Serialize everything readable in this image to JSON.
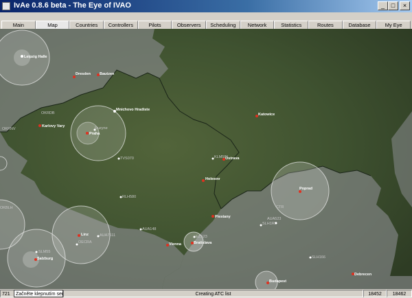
{
  "window": {
    "title": "IvAe 0.8.6 beta - The Eye of IVAO",
    "controls": [
      "_",
      "□",
      "×"
    ]
  },
  "tabs": [
    {
      "label": "Main"
    },
    {
      "label": "Map"
    },
    {
      "label": "Countries"
    },
    {
      "label": "Controllers"
    },
    {
      "label": "Pilots"
    },
    {
      "label": "Observers"
    },
    {
      "label": "Scheduling"
    },
    {
      "label": "Network"
    },
    {
      "label": "Statistics"
    },
    {
      "label": "Routes"
    },
    {
      "label": "Database"
    },
    {
      "label": "My Eye"
    }
  ],
  "active_tab": "Map",
  "map": {
    "cities": [
      {
        "name": "Leipzig Halle"
      },
      {
        "name": "Dresden"
      },
      {
        "name": "Bautzen"
      },
      {
        "name": "Mnichovo Hradiste"
      },
      {
        "name": "Karlovy Vary"
      },
      {
        "name": "Praha"
      },
      {
        "name": "Katowice"
      },
      {
        "name": "Ostrava"
      },
      {
        "name": "Holesov"
      },
      {
        "name": "Poprad"
      },
      {
        "name": "Piestany"
      },
      {
        "name": "Linz"
      },
      {
        "name": "Vienna"
      },
      {
        "name": "Bratislava"
      },
      {
        "name": "Salzburg"
      },
      {
        "name": "Budapest"
      },
      {
        "name": "Debrecen"
      },
      {
        "name": "Ruzyne"
      }
    ],
    "waypoints": [
      {
        "name": "TVS070"
      },
      {
        "name": "RLH580"
      },
      {
        "name": "AUA148"
      },
      {
        "name": "AUA7611"
      },
      {
        "name": "OECRA"
      },
      {
        "name": "SLH166"
      },
      {
        "name": "KLM581"
      },
      {
        "name": "EZS23"
      },
      {
        "name": "CTR"
      },
      {
        "name": "SLH1RP"
      },
      {
        "name": "SLM55"
      },
      {
        "name": "OKRNV"
      },
      {
        "name": "OKRDB"
      },
      {
        "name": "OKBLH"
      },
      {
        "name": "AUA523"
      }
    ],
    "colors": {
      "city_dot": "#e03020",
      "waypoint_dot": "#ffffff",
      "coverage_ring": "#f0f0f0"
    }
  },
  "status": {
    "count": "721",
    "hint": "Začněte klepnutím sem...",
    "message": "Creating ATC list",
    "value1": "18452",
    "value2": "18462"
  }
}
